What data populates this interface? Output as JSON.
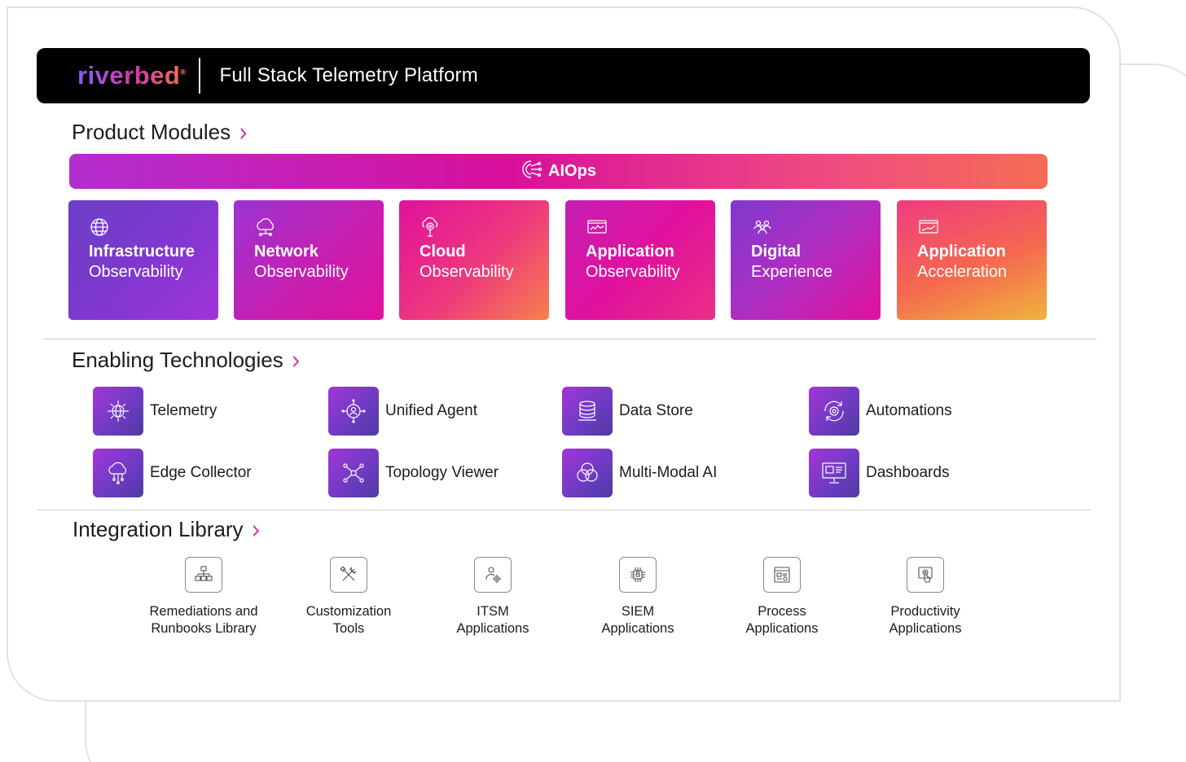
{
  "header": {
    "logo_text": "riverbed",
    "logo_mark": "®",
    "title": "Full Stack Telemetry Platform"
  },
  "product_modules": {
    "title": "Product Modules",
    "aiops_label": "AIOps",
    "aiops_icon": "ai-brain-icon",
    "modules": [
      {
        "line1": "Infrastructure",
        "line2": "Observability",
        "icon": "globe-icon"
      },
      {
        "line1": "Network",
        "line2": "Observability",
        "icon": "cloud-network-icon"
      },
      {
        "line1": "Cloud",
        "line2": "Observability",
        "icon": "cloud-search-icon"
      },
      {
        "line1": "Application",
        "line2": "Observability",
        "icon": "app-monitor-icon"
      },
      {
        "line1": "Digital",
        "line2": "Experience",
        "icon": "users-icon"
      },
      {
        "line1": "Application",
        "line2": "Acceleration",
        "icon": "speed-chart-icon"
      }
    ]
  },
  "enabling_technologies": {
    "title": "Enabling Technologies",
    "items": [
      {
        "label": "Telemetry",
        "icon": "telemetry-icon"
      },
      {
        "label": "Unified Agent",
        "icon": "agent-icon"
      },
      {
        "label": "Data Store",
        "icon": "database-icon"
      },
      {
        "label": "Automations",
        "icon": "gear-cycle-icon"
      },
      {
        "label": "Edge Collector",
        "icon": "edge-cloud-icon"
      },
      {
        "label": "Topology Viewer",
        "icon": "topology-icon"
      },
      {
        "label": "Multi-Modal AI",
        "icon": "venn-icon"
      },
      {
        "label": "Dashboards",
        "icon": "dashboard-icon"
      }
    ]
  },
  "integration_library": {
    "title": "Integration Library",
    "items": [
      {
        "line1": "Remediations and",
        "line2": "Runbooks Library",
        "icon": "hierarchy-icon"
      },
      {
        "line1": "Customization",
        "line2": "Tools",
        "icon": "tools-icon"
      },
      {
        "line1": "ITSM",
        "line2": "Applications",
        "icon": "service-user-icon"
      },
      {
        "line1": "SIEM",
        "line2": "Applications",
        "icon": "security-chip-icon"
      },
      {
        "line1": "Process",
        "line2": "Applications",
        "icon": "process-doc-icon"
      },
      {
        "line1": "Productivity",
        "line2": "Applications",
        "icon": "touch-screen-icon"
      }
    ]
  },
  "colors": {
    "pink_accent": "#d63aa7",
    "purple": "#7a35c9",
    "magenta": "#d8109c",
    "orange": "#f56d55"
  }
}
